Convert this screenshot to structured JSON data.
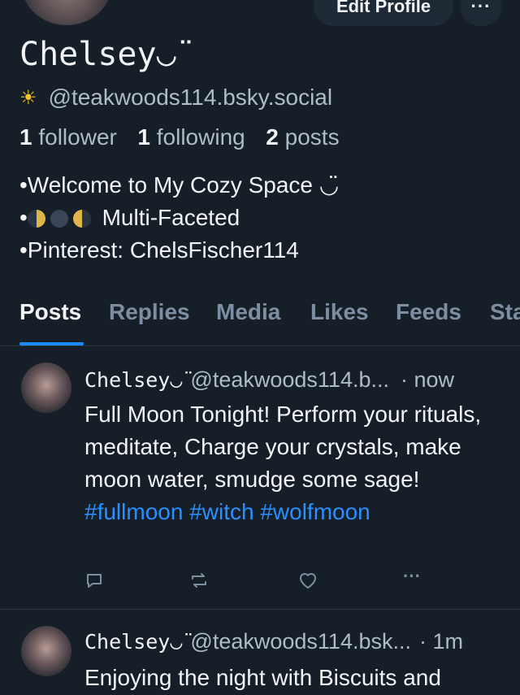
{
  "header": {
    "edit_profile_label": "Edit Profile",
    "more_label": "···"
  },
  "profile": {
    "display_name": "Chelsey◡̈",
    "handle": "@teakwoods114.bsky.social",
    "handle_icon": "sun-icon",
    "followers_count": "1",
    "followers_label": "follower",
    "following_count": "1",
    "following_label": "following",
    "posts_count": "2",
    "posts_label": "posts",
    "bio": {
      "line1": "•Welcome to My Cozy Space ◡̈",
      "line2_prefix": "•",
      "line2_text": "Multi-Faceted",
      "line3": "•Pinterest: ChelsFischer114"
    }
  },
  "tabs": [
    {
      "label": "Posts",
      "active": true
    },
    {
      "label": "Replies",
      "active": false
    },
    {
      "label": "Media",
      "active": false
    },
    {
      "label": "Likes",
      "active": false
    },
    {
      "label": "Feeds",
      "active": false
    },
    {
      "label": "Sta",
      "active": false
    }
  ],
  "posts": [
    {
      "author": "Chelsey◡̈",
      "handle": "@teakwoods114.b...",
      "time": "· now",
      "text_before": "Full Moon Tonight! Perform your rituals, meditate, Charge your crystals, make moon water, smudge some sage! ",
      "tags": [
        "#fullmoon",
        "#witch",
        "#wolfmoon"
      ],
      "actions": {
        "reply_icon": "reply-icon",
        "repost_icon": "repost-icon",
        "like_icon": "heart-icon",
        "more_label": "···"
      }
    },
    {
      "author": "Chelsey◡̈",
      "handle": "@teakwoods114.bsk...",
      "time": "· 1m",
      "text": "Enjoying the night with Biscuits and"
    }
  ],
  "colors": {
    "background": "#161e27",
    "link": "#2a8fff",
    "muted": "#aebbc9",
    "tab_active_underline": "#1a8cff"
  }
}
